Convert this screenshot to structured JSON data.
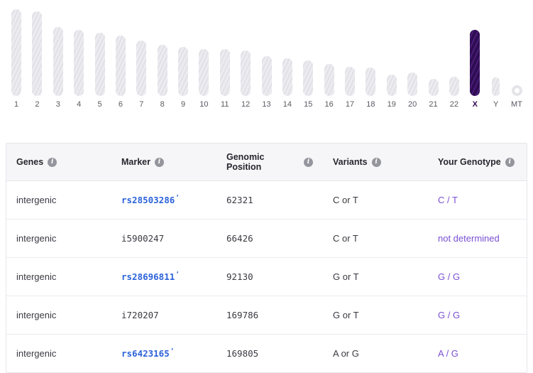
{
  "ideogram": {
    "selected_chromosome": "X",
    "selected_color": "#2e0d52",
    "default_color": "#e7e7ec",
    "chromosomes": [
      {
        "label": "1"
      },
      {
        "label": "2"
      },
      {
        "label": "3"
      },
      {
        "label": "4"
      },
      {
        "label": "5"
      },
      {
        "label": "6"
      },
      {
        "label": "7"
      },
      {
        "label": "8"
      },
      {
        "label": "9"
      },
      {
        "label": "10"
      },
      {
        "label": "11"
      },
      {
        "label": "12"
      },
      {
        "label": "13"
      },
      {
        "label": "14"
      },
      {
        "label": "15"
      },
      {
        "label": "16"
      },
      {
        "label": "17"
      },
      {
        "label": "18"
      },
      {
        "label": "19"
      },
      {
        "label": "20"
      },
      {
        "label": "21"
      },
      {
        "label": "22"
      },
      {
        "label": "X"
      },
      {
        "label": "Y"
      },
      {
        "label": "MT"
      }
    ]
  },
  "table": {
    "columns": [
      {
        "label": "Genes"
      },
      {
        "label": "Marker"
      },
      {
        "label": "Genomic Position"
      },
      {
        "label": "Variants"
      },
      {
        "label": "Your Genotype"
      }
    ],
    "link_color": "#2b63d9",
    "genotype_color": "#7a4fd3",
    "rows": [
      {
        "gene": "intergenic",
        "marker": "rs28503286",
        "marker_is_link": true,
        "position": "62321",
        "variants": "C or T",
        "genotype": "C / T"
      },
      {
        "gene": "intergenic",
        "marker": "i5900247",
        "marker_is_link": false,
        "position": "66426",
        "variants": "C or T",
        "genotype": "not determined"
      },
      {
        "gene": "intergenic",
        "marker": "rs28696811",
        "marker_is_link": true,
        "position": "92130",
        "variants": "G or T",
        "genotype": "G / G"
      },
      {
        "gene": "intergenic",
        "marker": "i720207",
        "marker_is_link": false,
        "position": "169786",
        "variants": "G or T",
        "genotype": "G / G"
      },
      {
        "gene": "intergenic",
        "marker": "rs6423165",
        "marker_is_link": true,
        "position": "169805",
        "variants": "A or G",
        "genotype": "A / G"
      }
    ]
  }
}
